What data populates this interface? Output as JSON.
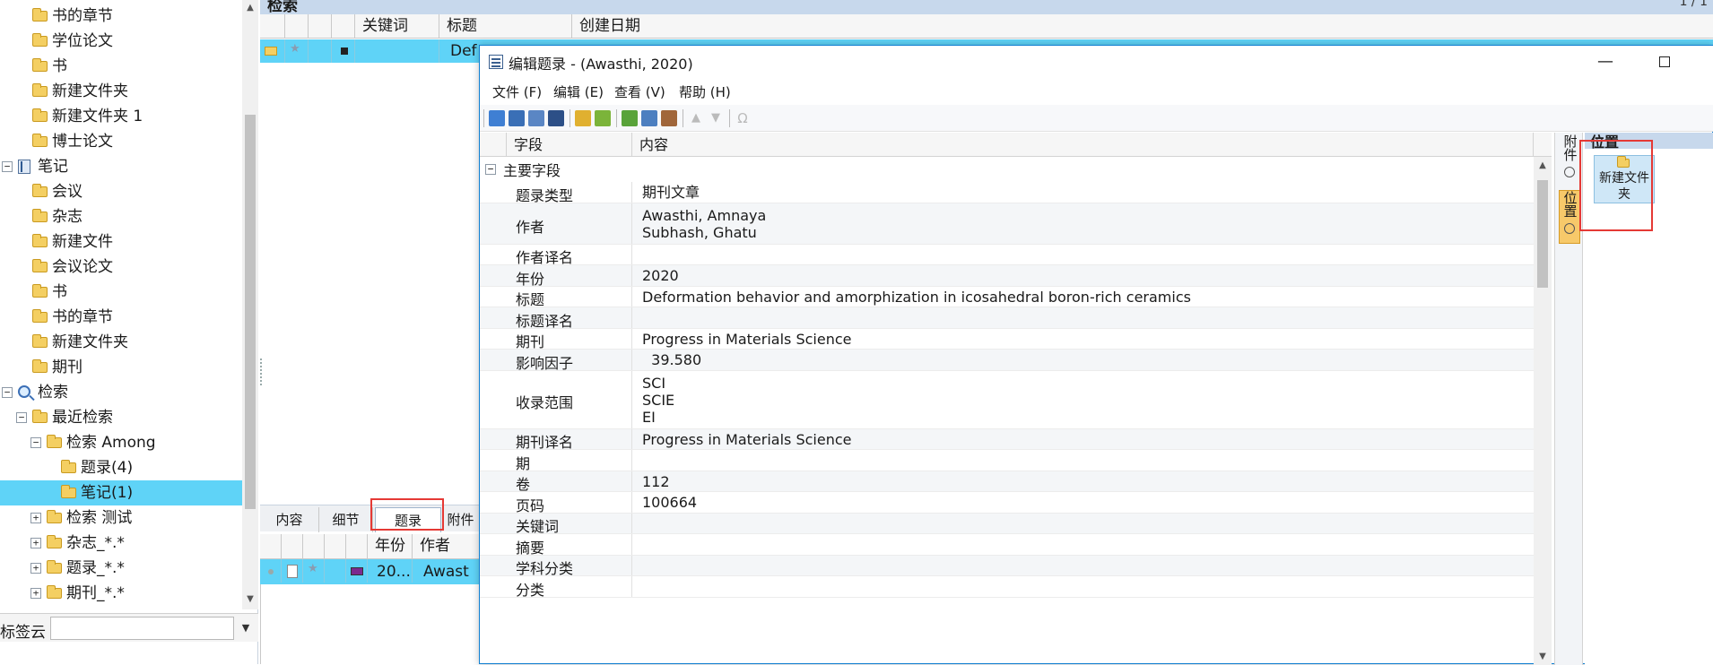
{
  "tree": {
    "items": [
      {
        "label": "书的章节",
        "level": 2,
        "icon": "folder-icon"
      },
      {
        "label": "学位论文",
        "level": 2,
        "icon": "folder-icon"
      },
      {
        "label": "书",
        "level": 2,
        "icon": "folder-icon"
      },
      {
        "label": "新建文件夹",
        "level": 2,
        "icon": "folder-icon"
      },
      {
        "label": "新建文件夹 1",
        "level": 2,
        "icon": "folder-icon"
      },
      {
        "label": "博士论文",
        "level": 2,
        "icon": "folder-icon"
      },
      {
        "label": "笔记",
        "level": 1,
        "icon": "notebook-icon",
        "expander": "−"
      },
      {
        "label": "会议",
        "level": 2,
        "icon": "folder-icon"
      },
      {
        "label": "杂志",
        "level": 2,
        "icon": "folder-icon"
      },
      {
        "label": "新建文件",
        "level": 2,
        "icon": "folder-icon"
      },
      {
        "label": "会议论文",
        "level": 2,
        "icon": "folder-icon"
      },
      {
        "label": "书",
        "level": 2,
        "icon": "folder-icon"
      },
      {
        "label": "书的章节",
        "level": 2,
        "icon": "folder-icon"
      },
      {
        "label": "新建文件夹",
        "level": 2,
        "icon": "folder-icon"
      },
      {
        "label": "期刊",
        "level": 2,
        "icon": "folder-icon"
      },
      {
        "label": "检索",
        "level": 1,
        "icon": "search-icon",
        "expander": "−"
      },
      {
        "label": "最近检索",
        "level": 2,
        "icon": "folder-icon",
        "expander": "−"
      },
      {
        "label": "检索 Among",
        "level": 3,
        "icon": "folder-icon",
        "expander": "−"
      },
      {
        "label": "题录(4)",
        "level": 4,
        "icon": "folder-icon"
      },
      {
        "label": "笔记(1)",
        "level": 4,
        "icon": "folder-icon",
        "selected": true
      },
      {
        "label": "检索 测试",
        "level": 3,
        "icon": "folder-icon",
        "expander": "+"
      },
      {
        "label": "杂志_*.*",
        "level": 3,
        "icon": "folder-icon",
        "expander": "+"
      },
      {
        "label": "题录_*.*",
        "level": 3,
        "icon": "folder-icon",
        "expander": "+"
      },
      {
        "label": "期刊_*.*",
        "level": 3,
        "icon": "folder-icon",
        "expander": "+"
      }
    ]
  },
  "tag_cloud": {
    "label": "标签云",
    "value": ""
  },
  "search_panel": {
    "title": "检索",
    "page_indicator": "1 / 1",
    "columns": [
      "关键词",
      "标题",
      "创建日期"
    ],
    "row_title_fragment": "Def"
  },
  "bottom_tabs": [
    "内容",
    "细节",
    "题录",
    "附件"
  ],
  "bottom_table": {
    "columns": [
      "年份",
      "作者"
    ],
    "row": {
      "year": "20...",
      "author": "Awast"
    }
  },
  "dialog": {
    "title": "编辑题录 - (Awasthi, 2020)",
    "menu": [
      "文件 (F)",
      "编辑 (E)",
      "查看 (V)",
      "帮助 (H)"
    ],
    "grid_columns": [
      "字段",
      "内容"
    ],
    "group_label": "主要字段",
    "fields": [
      {
        "name": "题录类型",
        "value": [
          "期刊文章"
        ]
      },
      {
        "name": "作者",
        "value": [
          "Awasthi, Amnaya",
          "Subhash, Ghatu"
        ]
      },
      {
        "name": "作者译名",
        "value": []
      },
      {
        "name": "年份",
        "value": [
          "2020"
        ]
      },
      {
        "name": "标题",
        "value": [
          "Deformation behavior and amorphization in icosahedral boron-rich ceramics"
        ]
      },
      {
        "name": "标题译名",
        "value": []
      },
      {
        "name": "期刊",
        "value": [
          "Progress in Materials Science"
        ]
      },
      {
        "name": "影响因子",
        "value": [
          "  39.580"
        ]
      },
      {
        "name": "收录范围",
        "value": [
          "SCI",
          "SCIE",
          "EI"
        ]
      },
      {
        "name": "期刊译名",
        "value": [
          "Progress in Materials Science"
        ]
      },
      {
        "name": "期",
        "value": []
      },
      {
        "name": "卷",
        "value": [
          "112"
        ]
      },
      {
        "name": "页码",
        "value": [
          "100664"
        ]
      },
      {
        "name": "关键词",
        "value": []
      },
      {
        "name": "摘要",
        "value": []
      },
      {
        "name": "学科分类",
        "value": []
      },
      {
        "name": "分类",
        "value": []
      }
    ],
    "side_tabs": [
      {
        "label": "附件",
        "active": false
      },
      {
        "label": "位置",
        "active": true
      }
    ],
    "location_panel": {
      "title": "位置",
      "item_label": "新建文件夹"
    }
  }
}
